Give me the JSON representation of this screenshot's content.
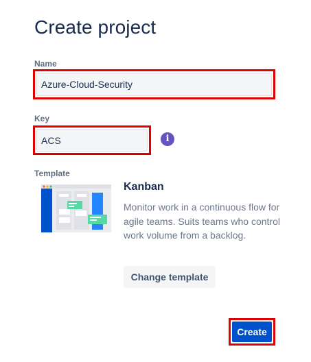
{
  "page": {
    "title": "Create project"
  },
  "name_field": {
    "label": "Name",
    "value": "Azure-Cloud-Security"
  },
  "key_field": {
    "label": "Key",
    "value": "ACS",
    "info_icon_glyph": "i"
  },
  "template": {
    "label": "Template",
    "name": "Kanban",
    "description": "Monitor work in a continuous flow for agile teams. Suits teams who control work volume from a backlog.",
    "change_button_label": "Change template",
    "thumbnail_icon": "kanban-board-illustration"
  },
  "actions": {
    "create_label": "Create"
  },
  "colors": {
    "accent_blue": "#0052cc",
    "info_purple": "#6554c0",
    "highlight_red": "#e00000"
  }
}
